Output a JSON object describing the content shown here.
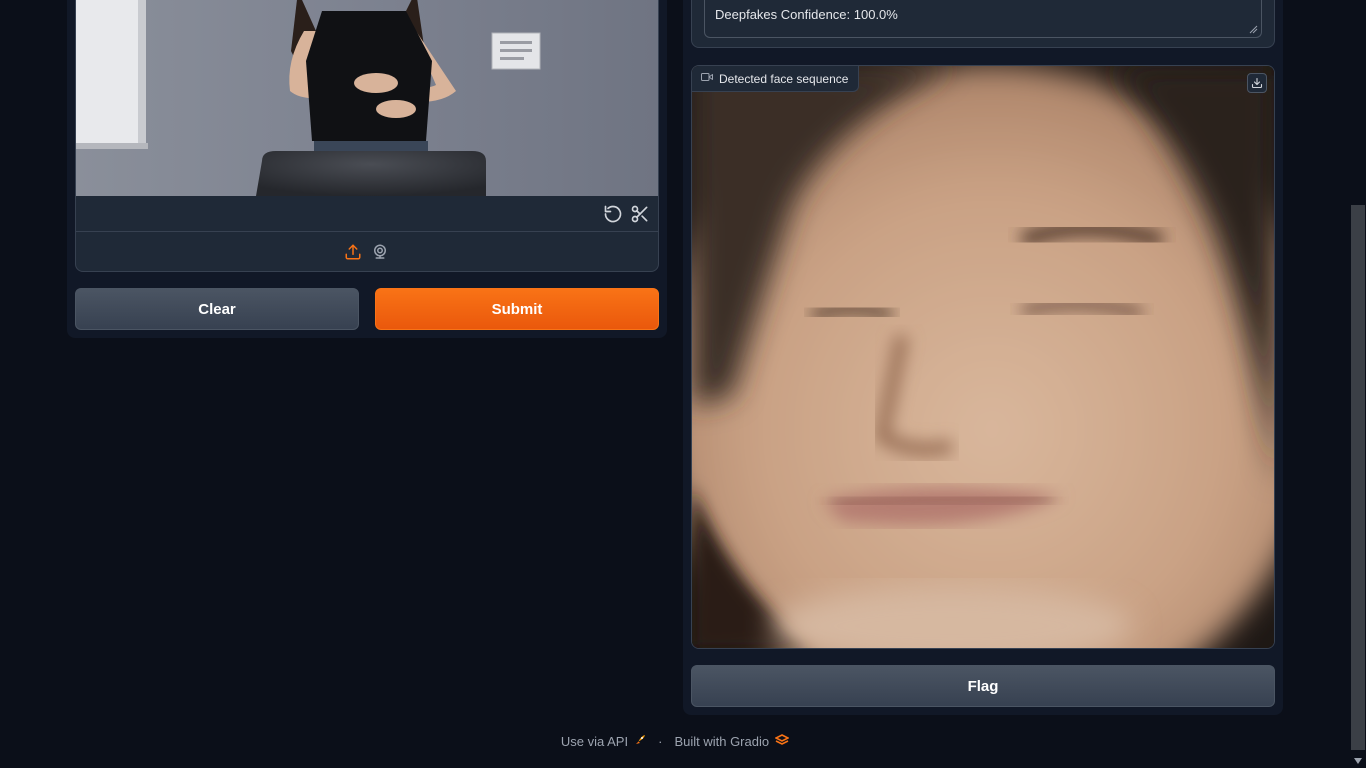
{
  "input_video": {
    "controls": {
      "reset_icon": "rotate-ccw-icon",
      "trim_icon": "scissors-icon"
    },
    "sources": {
      "upload_icon": "upload-icon",
      "webcam_icon": "webcam-icon"
    }
  },
  "actions": {
    "clear_label": "Clear",
    "submit_label": "Submit"
  },
  "output_text": {
    "value": "Deepfakes Confidence: 100.0%"
  },
  "output_video": {
    "label": "Detected face sequence",
    "label_icon": "video-icon",
    "download_icon": "download-icon"
  },
  "flag": {
    "label": "Flag"
  },
  "footer": {
    "api_link": "Use via API",
    "separator": "·",
    "built_with": "Built with Gradio"
  },
  "colors": {
    "background": "#0b0f19",
    "panel": "#111827",
    "block": "#1f2937",
    "border": "#374151",
    "accent": "#f97316"
  }
}
